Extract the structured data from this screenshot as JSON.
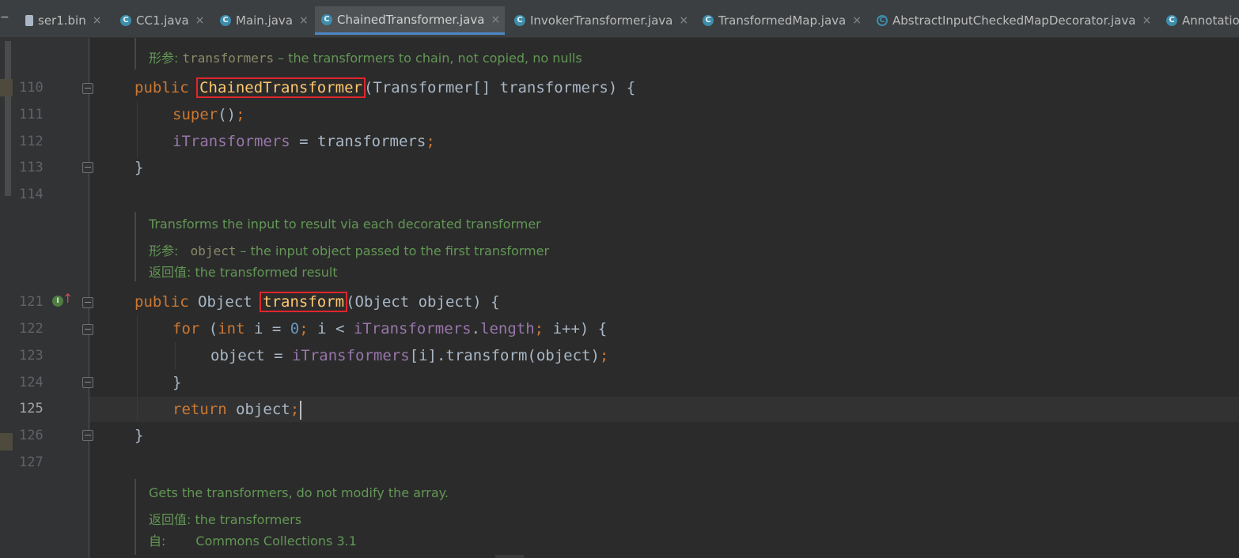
{
  "tabs": [
    {
      "label": "ser1.bin",
      "icon": "binary-file-icon",
      "active": false
    },
    {
      "label": "CC1.java",
      "icon": "java-class-icon",
      "active": false
    },
    {
      "label": "Main.java",
      "icon": "java-class-icon",
      "active": false
    },
    {
      "label": "ChainedTransformer.java",
      "icon": "java-class-icon",
      "active": true
    },
    {
      "label": "InvokerTransformer.java",
      "icon": "java-class-icon",
      "active": false
    },
    {
      "label": "TransformedMap.java",
      "icon": "java-class-icon",
      "active": false
    },
    {
      "label": "AbstractInputCheckedMapDecorator.java",
      "icon": "abstract-class-icon",
      "active": false
    },
    {
      "label": "Annotatio",
      "icon": "java-class-icon",
      "active": false
    }
  ],
  "tab_close_glyph": "×",
  "tab_icon_letter": "C",
  "left_edge_mark": "−",
  "top_doc": {
    "label": "形参:",
    "param": "transformers",
    "text": " – the transformers to chain, not copied, no nulls"
  },
  "lines": {
    "l110": "110",
    "l111": "111",
    "l112": "112",
    "l113": "113",
    "l114": "114",
    "l121": "121",
    "l122": "122",
    "l123": "123",
    "l124": "124",
    "l125": "125",
    "l126": "126",
    "l127": "127"
  },
  "code": {
    "l110": {
      "kw": "public ",
      "name": "ChainedTransformer",
      "rest": "(Transformer[] transformers) {"
    },
    "l111": {
      "kw": "super",
      "rest": "()",
      "semi": ";"
    },
    "l112": {
      "field": "iTransformers",
      "rest": " = transformers",
      "semi": ";"
    },
    "l113": {
      "text": "}"
    },
    "l121": {
      "kw": "public ",
      "type": "Object ",
      "name": "transform",
      "rest": "(Object object) {"
    },
    "l122": {
      "kw1": "for ",
      "p1": "(",
      "kw2": "int ",
      "p2": "i = ",
      "num": "0",
      "semi1": "; ",
      "p3": "i < ",
      "field": "iTransformers",
      "p4": ".",
      "field2": "length",
      "semi2": "; ",
      "p5": "i++) {"
    },
    "l123": {
      "p1": "object = ",
      "field": "iTransformers",
      "rest": "[i].transform(object)",
      "semi": ";"
    },
    "l124": {
      "text": "}"
    },
    "l125": {
      "kw": "return ",
      "rest": "object",
      "semi": ";"
    },
    "l126": {
      "text": "}"
    }
  },
  "doc_transform": {
    "summary": "Transforms the input to result via each decorated transformer",
    "param_label": "形参:",
    "param_name": "object",
    "param_text": " – the input object passed to the first transformer",
    "return_label": "返回值:",
    "return_text": " the transformed result"
  },
  "doc_get": {
    "summary": "Gets the transformers, do not modify the array.",
    "return_label": "返回值:",
    "return_text": " the transformers",
    "since_label": "自:",
    "since_text": "Commons Collections 3.1"
  },
  "impl_icon_letter": "I",
  "impl_arrow": "↑"
}
